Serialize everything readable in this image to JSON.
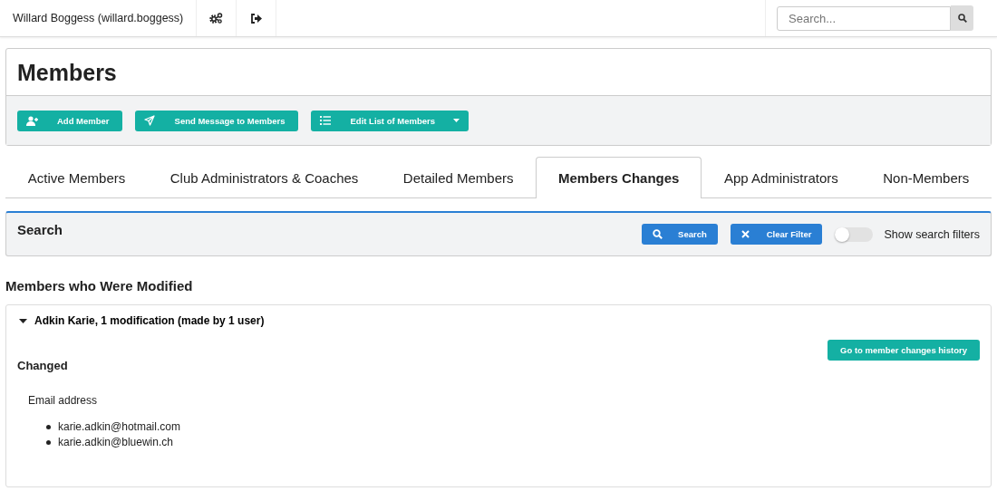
{
  "topbar": {
    "user": "Willard Boggess (willard.boggess)",
    "search": {
      "placeholder": "Search..."
    }
  },
  "page": {
    "title": "Members",
    "actions": [
      {
        "label": "Add Member",
        "kind": "add"
      },
      {
        "label": "Send Message to Members",
        "kind": "send"
      },
      {
        "label": "Edit List of Members",
        "kind": "list",
        "dropdown": true
      }
    ]
  },
  "tabs": [
    {
      "label": "Active Members",
      "selected": false
    },
    {
      "label": "Club Administrators & Coaches",
      "selected": false
    },
    {
      "label": "Detailed Members",
      "selected": false
    },
    {
      "label": "Members Changes",
      "selected": true
    },
    {
      "label": "App Administrators",
      "selected": false
    },
    {
      "label": "Non-Members",
      "selected": false
    }
  ],
  "search_panel": {
    "title": "Search",
    "buttons": [
      {
        "label": "Search",
        "kind": "search"
      },
      {
        "label": "Clear Filter",
        "kind": "clear"
      }
    ],
    "toggle": {
      "label": "Show search filters",
      "on": false
    }
  },
  "section_title": "Members who Were Modified",
  "changes": [
    {
      "title": "Adkin Karie, 1 modification (made by 1 user)",
      "expanded": true,
      "history_button": "Go to member changes history",
      "group": "Changed",
      "field": "Email address",
      "values": [
        "karie.adkin@hotmail.com",
        "karie.adkin@bluewin.ch"
      ]
    }
  ]
}
